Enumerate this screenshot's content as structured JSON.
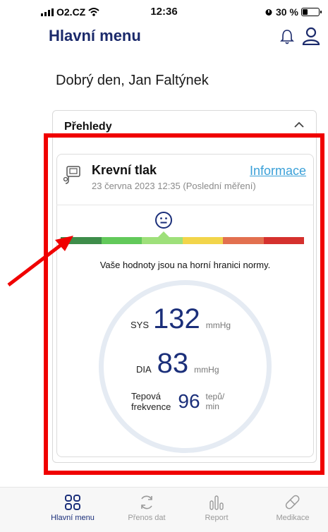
{
  "status_bar": {
    "carrier": "O2.CZ",
    "time": "12:36",
    "battery": "30 %"
  },
  "header": {
    "title": "Hlavní menu"
  },
  "greeting": "Dobrý den, Jan Faltýnek",
  "overview": {
    "title": "Přehledy",
    "card": {
      "title": "Krevní tlak",
      "date": "23 června 2023 12:35 (Poslední měření)",
      "info_link": "Informace",
      "scale_colors": [
        "#3e8d4a",
        "#62c95a",
        "#9ee07a",
        "#f2d54a",
        "#e2704f",
        "#d5312e"
      ],
      "message": "Vaše hodnoty jsou na horní hranici normy.",
      "sys_label": "SYS",
      "sys_value": "132",
      "sys_unit": "mmHg",
      "dia_label": "DIA",
      "dia_value": "83",
      "dia_unit": "mmHg",
      "hr_label_1": "Tepová",
      "hr_label_2": "frekvence",
      "hr_value": "96",
      "hr_unit_1": "tepů/",
      "hr_unit_2": "min"
    }
  },
  "nav": [
    {
      "label": "Hlavní menu",
      "icon": "grid-icon",
      "active": true
    },
    {
      "label": "Přenos dat",
      "icon": "sync-icon",
      "active": false
    },
    {
      "label": "Report",
      "icon": "chart-icon",
      "active": false
    },
    {
      "label": "Medikace",
      "icon": "pill-icon",
      "active": false
    }
  ]
}
